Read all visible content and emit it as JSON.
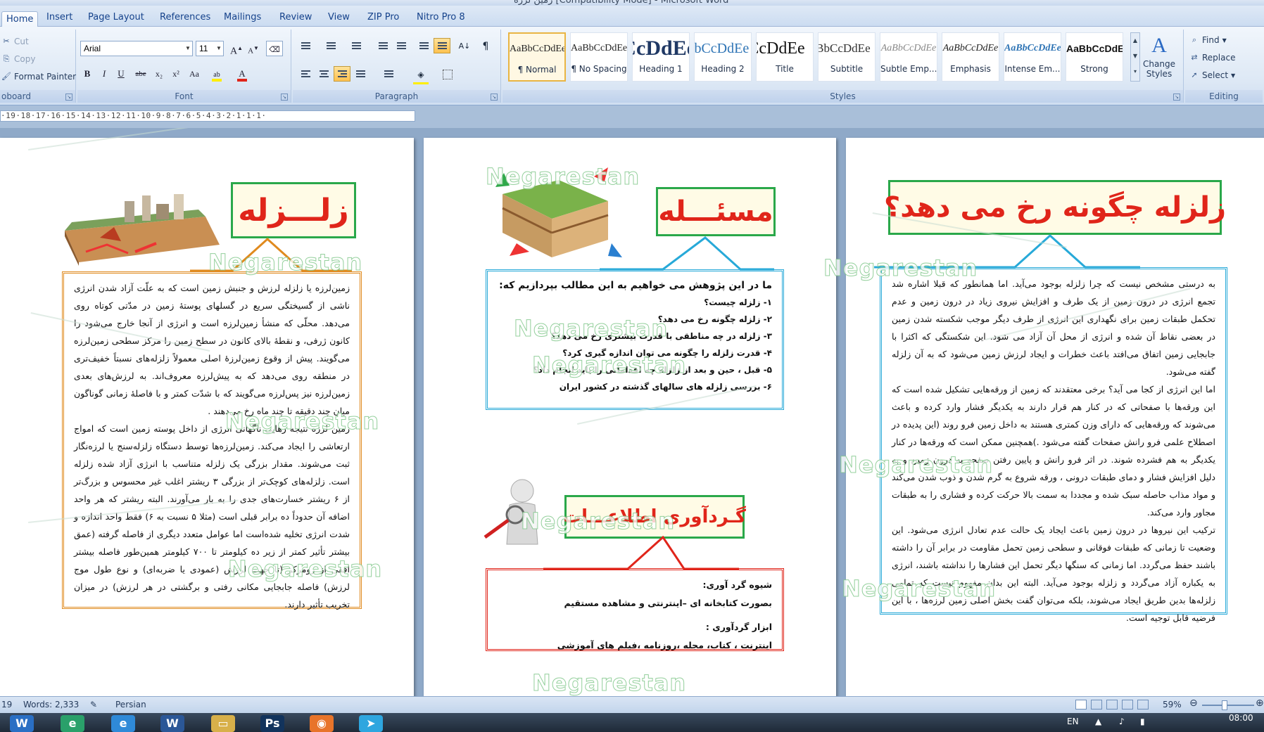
{
  "window": {
    "title": "زمین لرزه [Compatibility Mode] - Microsoft Word"
  },
  "tabs": [
    "Home",
    "Insert",
    "Page Layout",
    "References",
    "Mailings",
    "Review",
    "View",
    "ZIP Pro",
    "Nitro Pro 8"
  ],
  "clipboard": {
    "cut": "Cut",
    "copy": "Copy",
    "format_painter": "Format Painter",
    "label": "oboard"
  },
  "font": {
    "name": "Arial",
    "size": "11",
    "label": "Font",
    "bold": "B",
    "italic": "I",
    "underline": "U",
    "strike": "abe",
    "sub": "x₂",
    "sup": "x²",
    "case": "Aa",
    "grow": "A",
    "shrink": "A"
  },
  "paragraph": {
    "label": "Paragraph",
    "pilcrow": "¶"
  },
  "styles": {
    "label": "Styles",
    "items": [
      {
        "sample": "AaBbCcDdEe",
        "name": "¶ Normal"
      },
      {
        "sample": "AaBbCcDdEe",
        "name": "¶ No Spacing"
      },
      {
        "sample": "AaBbCcDdEe",
        "name": "Heading 1"
      },
      {
        "sample": "AaBbCcDdEe",
        "name": "Heading 2"
      },
      {
        "sample": "AaBbCcDdEe",
        "name": "Title"
      },
      {
        "sample": "AaBbCcDdEe",
        "name": "Subtitle"
      },
      {
        "sample": "AaBbCcDdEe",
        "name": "Subtle Emp..."
      },
      {
        "sample": "AaBbCcDdEe",
        "name": "Emphasis"
      },
      {
        "sample": "AaBbCcDdEe",
        "name": "Intense Em..."
      },
      {
        "sample": "AaBbCcDdEe",
        "name": "Strong"
      }
    ],
    "change_styles": "Change Styles",
    "change_glyph": "A"
  },
  "editing": {
    "label": "Editing",
    "find": "Find",
    "replace": "Replace",
    "select": "Select"
  },
  "ruler": {
    "text": "·19·18·17·16·15·14·13·12·11·10·9·8·7·6·5·4·3·2·1·1·1·"
  },
  "page_right": {
    "heading": "زلزله چگونه رخ می دهد؟",
    "paragraphs": [
      "به درستی مشخص نیست که چرا زلزله بوجود می‌آید. اما همانطور که قبلا اشاره شد تجمع انرژی در درون زمین از یک طرف و افزایش نیروی زیاد در درون زمین و عدم تحکمل طبقات زمین برای نگهداری این انرژی از طرف دیگر موجب شکسته شدن زمین در بعضی نقاط آن شده و انرژی از محل آن آزاد می شود. این شکستگی که اکثرا با جابجایی زمین اتفاق می‌افتد باعث خطرات و ایجاد لرزش زمین می‌شود که به آن زلزله گفته می‌شود.",
      "اما این انرژی از کجا می آید؟ برخی معتقدند که زمین از ورقه‌هایی تشکیل شده است که این ورقه‌ها با صفحاتی که در کنار هم قرار دارند به یکدیگر فشار وارد کرده و باعث می‌شوند که ورقه‌هایی که دارای وزن کمتری هستند به داخل زمین فرو روند (این پدیده در اصطلاح علمی فرو رانش صفحات گفته می‌شود .)همچنین ممکن است که ورقه‌ها در کنار یکدیگر به هم فشرده شوند. در اثر فرو رانش و پایین رفتن صفحه به درون زمین و به دلیل افزایش فشار و دمای طبقات درونی ، ورقه شروع به گرم شدن و ذوب شدن می‌کند و مواد مذاب حاصله سبک شده و مجددا به سمت بالا حرکت کرده و فشاری را به طبقات مجاور وارد می‌کند.",
      "ترکیب این نیروها در درون زمین باعث ایجاد یک حالت عدم تعادل انرژی می‌شود. این وضعیت تا زمانی که طبقات فوقانی و سطحی زمین تحمل مقاومت در برابر آن را داشته باشند حفظ می‌گردد. اما زمانی که سنگها دیگر تحمل این فشارها را نداشته باشند، انرژی به یکباره آزاد می‌گردد و زلزله بوجود می‌آید. البته این بدان مفهوم نیست که تمامی زلزله‌ها بدین طریق ایجاد می‌شوند، بلکه می‌توان گفت بخش اصلی زمین لرزه‌ها ، با این فرضیه قابل توجیه است."
    ]
  },
  "page_middle": {
    "heading1": "مسئـــله",
    "intro": "ما در این پژوهش می خواهیم به این مطالب بپردازیم که:",
    "questions": [
      "۱- زلزله چیست؟",
      "۲- زلزله چگونه رخ می دهد؟",
      "۳- زلزله در چه مناطقی با قدرت بیشتری رخ می دهد؟",
      "۴- قدرت زلزله را چگونه می توان اندازه گیری کرد؟",
      "۵- قبل ، حین و بعد از زلزله چه اقداماتی را باید انجام داد؟",
      "۶- بررسی زلزله های سالهای گذشته در کشور ایران"
    ],
    "heading2": "گـردآوری اطلاعـــات",
    "method_title": "شیوه گرد آوری:",
    "method_text": "بصورت کتابخانه ای –اینترنتی و مشاهده مستقیم",
    "tools_title": "ابزار گردآوری :",
    "tools_text": "اینترنت ، کتاب، مجله ،روزنامه ،فیلم های آموزشی"
  },
  "page_left": {
    "heading": "زلـــزله",
    "paragraphs": [
      "زمین‌لرزه یا زلزله لرزش و جنبش زمین است که به علّت آزاد شدن انرژی ناشی از گسیختگی سریع در گسلهای پوستهٔ زمین در مدّتی کوتاه روی می‌دهد. محلّی که منشأ زمین‌لرزه است و انرژی از آنجا خارج می‌شود را کانون ژرفی، و نقطهٔ بالای کانون در سطح زمین را مرکز سطحی زمین‌لرزه می‌گویند. پیش از وقوع زمین‌لرزهٔ اصلی معمولاً زلزله‌های نسبتاً خفیف‌تری در منطقه روی می‌دهد که به پیش‌لرزه معروف‌اند. به لرزش‌های بعدی زمین‌لرزه نیز پس‌لرزه می‌گویند که با شدّت کمتر و با فاصلهٔ زمانی گوناگون میان چند دقیقه تا چند ماه رخ می‌دهند .",
      "زمین لرزه نتیجه رهایی ناگهانی انرژی از داخل پوسته زمین است که امواج ارتعاشی را ایجاد می‌کند. زمین‌لرزه‌ها توسط دستگاه زلزله‌سنج یا لرزه‌نگار ثبت می‌شوند. مقدار بزرگی یک زلزله متناسب با انرژی آزاد شده زلزله است. زلزله‌های کوچک‌تر از بزرگی ۳ ریشتر اغلب غیر محسوس و بزرگ‌تر از ۶ ریشتر خسارت‌های جدی را به بار می‌آورند. البته ریشتر که هر واحد اضافه آن حدوداً ده برابر قبلی است (مثلا ۵ نسبت به ۶) فقط واحد اندازه و شدت انرژی تخلیه شده‌است اما عوامل متعدد دیگری از فاصله گرفته (عمق بیشتر تأثیر کمتر از زیر ده کیلومتر تا ۷۰۰ کیلومتر همین‌طور فاصله بیشتر افقی از رومرکز (تا جهت لرزش (عمودی یا ضربه‌ای) و نوع طول موج لرزش) فاصله جابجایی مکانی رفتی و برگشتی در هر لرزش) در میزان تخریب تأثیر دارند."
    ]
  },
  "watermark": "Negarestan",
  "status": {
    "page": "19",
    "words": "Words: 2,333",
    "language": "Persian",
    "zoom": "59%"
  },
  "tray": {
    "lang": "EN",
    "time": "08:00"
  },
  "colors": {
    "accent_red": "#e0251a",
    "box_green": "#2aa84a",
    "box_cyan": "#27a9d8",
    "box_orange": "#e08a1e"
  }
}
